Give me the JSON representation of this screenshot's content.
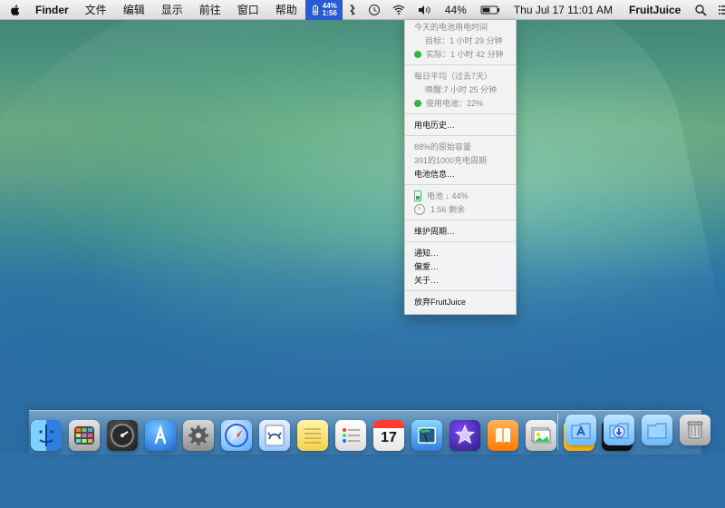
{
  "menubar": {
    "app_name": "Finder",
    "items": [
      "文件",
      "编辑",
      "显示",
      "前往",
      "窗口",
      "帮助"
    ],
    "fruitjuice_status": {
      "percent": "44%",
      "time": "1:56"
    },
    "battery_percent": "44%",
    "datetime": "Thu Jul 17  11:01 AM",
    "fruitjuice_label": "FruitJuice"
  },
  "fruitjuice_menu": {
    "today_header": "今天的电池用电时间",
    "target": "目标：1 小时 29 分钟",
    "actual": "实际：1 小时 42 分钟",
    "avg_header": "每日平均（过去7天）",
    "awake": "唤醒:7 小时 25 分钟",
    "battery_used": "使用电池：22%",
    "history": "用电历史…",
    "capacity": "88%的原始容量",
    "cycles": "391的1000充电周期",
    "battery_info": "电池信息…",
    "battery_status": "电池 ↓ 44%",
    "remaining": "1:56 剩余",
    "maintenance": "维护周期…",
    "notifications": "通知…",
    "preferences": "偏爱…",
    "about": "关于…",
    "quit": "放弃FruitJuice"
  },
  "colors": {
    "menubar_top": "#f4f4f4",
    "menubar_bottom": "#dcdcdc",
    "menu_bg": "#f5f5f5",
    "active_status_bg": "#2a5bd6",
    "ok_green": "#2fb54a"
  },
  "dock": {
    "apps": [
      {
        "name": "finder-icon"
      },
      {
        "name": "launchpad-icon"
      },
      {
        "name": "dashboard-icon"
      },
      {
        "name": "app-store-icon"
      },
      {
        "name": "system-preferences-icon"
      },
      {
        "name": "safari-icon"
      },
      {
        "name": "mail-icon"
      },
      {
        "name": "notes-icon"
      },
      {
        "name": "reminders-icon"
      },
      {
        "name": "calendar-icon",
        "label": "17"
      },
      {
        "name": "iphoto-icon"
      },
      {
        "name": "imovie-icon"
      },
      {
        "name": "ibooks-icon"
      },
      {
        "name": "preview-icon"
      },
      {
        "name": "fruitjuice-icon"
      },
      {
        "name": "terminal-icon"
      }
    ],
    "folders": [
      {
        "name": "applications-folder-icon"
      },
      {
        "name": "downloads-folder-icon"
      },
      {
        "name": "documents-folder-icon"
      },
      {
        "name": "trash-icon"
      }
    ]
  }
}
